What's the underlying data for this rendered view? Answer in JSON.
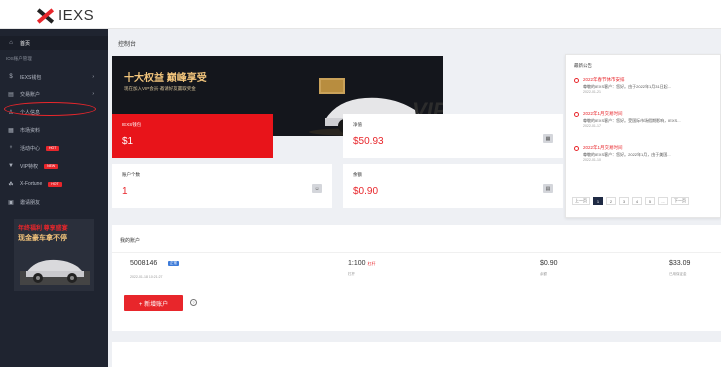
{
  "app": {
    "logo_text": "IEXS"
  },
  "sidebar": {
    "items": [
      {
        "icon": "⌂",
        "label": "首页",
        "arrow": "",
        "badge": ""
      },
      {
        "icon": "",
        "label": "IOS账户管理",
        "arrow": "",
        "badge": ""
      },
      {
        "icon": "$",
        "label": "IEXS钱包",
        "arrow": "›",
        "badge": ""
      },
      {
        "icon": "▤",
        "label": "交易账户",
        "arrow": "›",
        "badge": ""
      },
      {
        "icon": "♙",
        "label": "个人信息",
        "arrow": "",
        "badge": ""
      },
      {
        "icon": "▦",
        "label": "市场资料",
        "arrow": "",
        "badge": ""
      },
      {
        "icon": "♆",
        "label": "活动中心",
        "arrow": "",
        "badge": "HOT"
      },
      {
        "icon": "▼",
        "label": "VIP特权",
        "arrow": "",
        "badge": "NEW"
      },
      {
        "icon": "☘",
        "label": "X-Fortune",
        "arrow": "",
        "badge": "HOT"
      },
      {
        "icon": "▣",
        "label": "邀请朋友",
        "arrow": "",
        "badge": ""
      }
    ],
    "promo": {
      "line1": "年终福利 尊享盛宴",
      "line2": "现金豪车拿不停"
    }
  },
  "main": {
    "page_title": "控制台",
    "banner": {
      "headline": "十大权益 巅峰享受",
      "sub": "现在加入VIP会员·邀请好友赢取奖金"
    },
    "cards": {
      "wallet": {
        "label": "IEXS钱包",
        "value": "$1"
      },
      "net": {
        "label": "净值",
        "value": "$50.93"
      },
      "accounts": {
        "label": "账户个数",
        "value": "1"
      },
      "balance": {
        "label": "余额",
        "value": "$0.90"
      }
    },
    "announcements": {
      "title": "最新公告",
      "items": [
        {
          "headline": "2022年春节休市安排",
          "body": "尊敬的IEXS客户：您好。由于2022年1月31日起...",
          "date": "2022-01-21"
        },
        {
          "headline": "2022年1月交易时间",
          "body": "尊敬的IEXS客户：您好。受国际市场假期影响，IEXS...",
          "date": "2022-01-17"
        },
        {
          "headline": "2022年1月交易时间",
          "body": "尊敬的IEXS客户：您好。2022年1月，由于美国...",
          "date": "2022-01-10"
        }
      ],
      "pager": [
        "上一页",
        "1",
        "2",
        "3",
        "4",
        "5",
        "...",
        "下一页"
      ]
    },
    "accounts_section": {
      "title": "我的账户",
      "row": {
        "number": "5008146",
        "tag": "正常",
        "date": "2022-01-18 10:21:27",
        "leverage": "1:100",
        "leverage_tag": "杠杆",
        "leverage_label": "杠杆",
        "balance": "$0.90",
        "balance_label": "余额",
        "equity": "$33.09",
        "equity_label": "已用保证金"
      },
      "add_button": "+ 新增账户",
      "help_icon": "?"
    }
  }
}
